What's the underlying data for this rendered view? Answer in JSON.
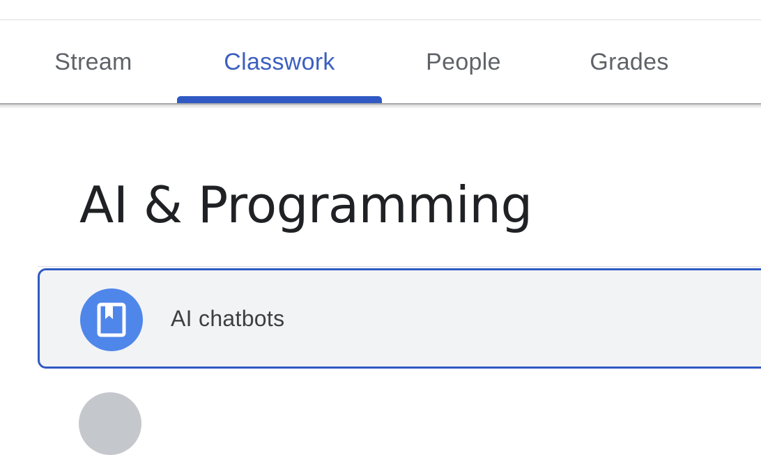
{
  "tabs": [
    {
      "label": "Stream",
      "active": false
    },
    {
      "label": "Classwork",
      "active": true
    },
    {
      "label": "People",
      "active": false
    },
    {
      "label": "Grades",
      "active": false
    }
  ],
  "topic": {
    "title": "AI & Programming"
  },
  "items": [
    {
      "label": "AI chatbots",
      "icon": "material-icon",
      "selected": true
    }
  ],
  "colors": {
    "accent": "#3059c3",
    "icon_bg": "#4f86ea",
    "card_bg": "#f1f3f4",
    "tab_inactive": "#5f6368"
  }
}
